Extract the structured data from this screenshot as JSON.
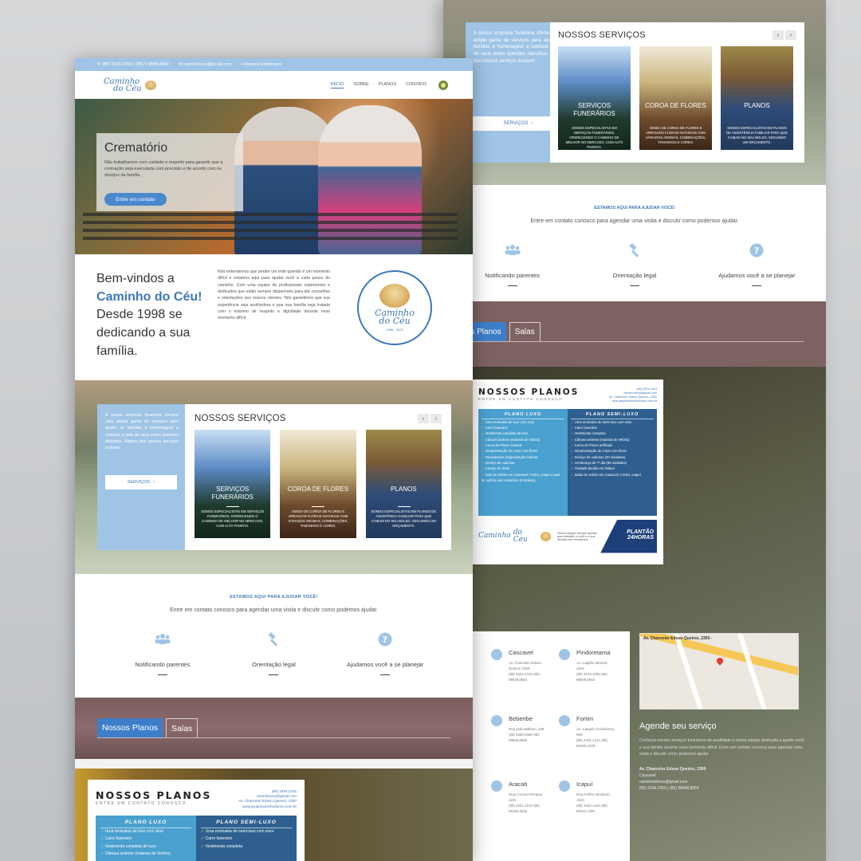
{
  "topbar": {
    "phones": "(85) 3334.2415 | (85) 9 9848.8854",
    "email": "caminhoceu@gmail.com",
    "location": "Nossos Endereços"
  },
  "nav": {
    "logo_line1": "Caminho",
    "logo_line2": "do Céu",
    "items": [
      "INÍCIO",
      "SOBRE",
      "PLANOS",
      "CONTATO"
    ]
  },
  "hero": {
    "title": "Crematório",
    "text": "Não trabalhamos com cuidado e respeito para garantir que a cremação seja executada com precisão e de acordo com os desejos da família.",
    "cta": "Entre em contato"
  },
  "welcome": {
    "heading_pre": "Bem-vindos a",
    "heading_brand": "Caminho do Céu!",
    "heading_post": "Desde 1998 se dedicando a sua família.",
    "text": "Nós entendemos que perder um ente querido é um momento difícil e estamos aqui para ajudar você a cada passo do caminho. Com uma equipe de profissionais experientes e dedicados que estão sempre disponíveis para dar conselhos e orientações aos nossos clientes. Nós garantimos que sua experiência seja acolhedora e que sua família seja tratada com o máximo de respeito e dignidade durante esse momento difícil.",
    "seal_line1": "Caminho",
    "seal_line2": "do Céu",
    "seal_years": "1998 - 2023"
  },
  "services": {
    "side_text": "A nossa empresa funerária oferece uma ampla gama de serviços para ajudar as famílias a homenagear e celebrar a vida de seus entes queridos falecidos. Alguns dos nossos serviços incluem:",
    "side_button": "SERVIÇOS",
    "title": "NOSSOS SERVIÇOS",
    "prev": "‹",
    "next": "›",
    "tiles": [
      {
        "title": "SERVIÇOS FUNERÁRIOS",
        "desc": "SOMOS ESPECIALISTAS EM SERVIÇOS FUNERÁRIOS, OFERECENDO O CAMINHO DE MELHOR NO MERCADO, COM ALTO PADRÃO."
      },
      {
        "title": "COROA DE FLORES",
        "desc": "VENDA DE COROA DE FLORES E ARRANJOS FLORAIS NATURAIS COM VARIADOS AROMAS, COMBINAÇÕES, TAMANHOS E CORES."
      },
      {
        "title": "PLANOS",
        "desc": "SOMOS ESPECIALISTAS EM PLANOS DE ASSISTÊNCIA FAMILIAR PARA QUE CAIBAM NO SEU BOLSO, SEGUINDO UM ORÇAMENTO."
      }
    ]
  },
  "help": {
    "kicker": "ESTAMOS AQUI PARA AJUDAR VOCÊ!",
    "sub": "Entre em contato conosco para agendar uma visita e discutir como podemos ajudar.",
    "features": [
      "Notificando parentes",
      "Orientação legal",
      "Ajudamos você a se planejar"
    ]
  },
  "plans_tabs": [
    "Nossos Planos",
    "Salas"
  ],
  "plans_card": {
    "title": "NOSSOS PLANOS",
    "subtitle": "ENTRE EM CONTATO CONOSCO",
    "phone": "(85) 3334.2415",
    "email": "caminhoceu@gmail.com",
    "address": "Av. Chanceler Edson Queiroz, 2300",
    "site": "www.grupocaminhodoceu.com.br",
    "luxo_title": "PLANO LUXO",
    "semi_title": "PLANO SEMI-LUXO",
    "luxo_items": [
      "Urna mortuária de luxo com visor",
      "Carro funerário",
      "Vestimenta completa de luxo",
      "Câmara ardente (material de Velório)",
      "Coroa de Flores naturais",
      "Ornamentação de corpo com flores",
      "Tanatopraxia (Higienização interna)",
      "Serviço de cadeiras",
      "Cortejo de Óbito",
      "Sala de velório em Cascavel, Fortim, Icapuí e taxa de velório nos cemitérios (Fortaleza)"
    ],
    "semi_items": [
      "Urna mortuária de semi-luxo com visor",
      "Carro funerário",
      "Vestimenta completa",
      "Câmara ardente (material de Velório)",
      "Coroa de Flores artificiais",
      "Ornamentação de corpo com flores",
      "Serviço de cadeiras (20 unidades)",
      "Lembrança de 7º dia (50 unidades)",
      "Traslado família em ônibus",
      "Salas de velório em Cascavel, Fortim, Icapuí"
    ],
    "footer_note": "Nossa equipe sempre aposta para atender a você e a sua família com excelência",
    "plantao": "PLANTÃO",
    "hours": "24HORAS"
  },
  "locations": [
    {
      "city": "Cascavel",
      "addr": "Av. Chanceler Edson Queiroz 2300",
      "phones": "(85) 3334.2415 (85) 98848.8854"
    },
    {
      "city": "Pindoretama",
      "addr": "Av. Capitão Moreira, 1526",
      "phones": "(85) 3275.1000 (85) 98848.8610"
    },
    {
      "city": "Beberibe",
      "addr": "Rua João Balbino, 228",
      "phones": "(85) 3338.1588 (85) 98848.8856"
    },
    {
      "city": "Fortim",
      "addr": "Av. Joaquim Crisóstomo, 865",
      "phones": "(85) 3421.1212 (85) 99150.3325"
    },
    {
      "city": "Aracati",
      "addr": "Rua Coronel Pompeu, 1191",
      "phones": "(85) 3421.1212 (85) 99150.3325"
    },
    {
      "city": "Icapuí",
      "addr": "Rua Porfírio Monteiro, 1544",
      "phones": "(85) 3432.1244 (85) 99116.7268"
    }
  ],
  "map": {
    "label": "Av. Chanceler Edson Queiroz, 2300 -"
  },
  "agende": {
    "title": "Agende seu serviço",
    "text": "Conheça nossos serviços funerários de qualidade e nossa equipe dedicada a ajudar você e sua família durante esse momento difícil. Entre em contato conosco para agendar uma visita e discutir como podemos ajudar.",
    "addr1": "Av. Chanceler Edson Queiroz, 2300",
    "addr2": "Cascavel",
    "email": "caminhodoceu@gmail.com",
    "phones": "(85) 3334.2415 | (85) 98848.8554"
  },
  "colors": {
    "primary": "#3d77b8",
    "accent_light": "#9fc4e6",
    "band": "#7a5d5d"
  }
}
